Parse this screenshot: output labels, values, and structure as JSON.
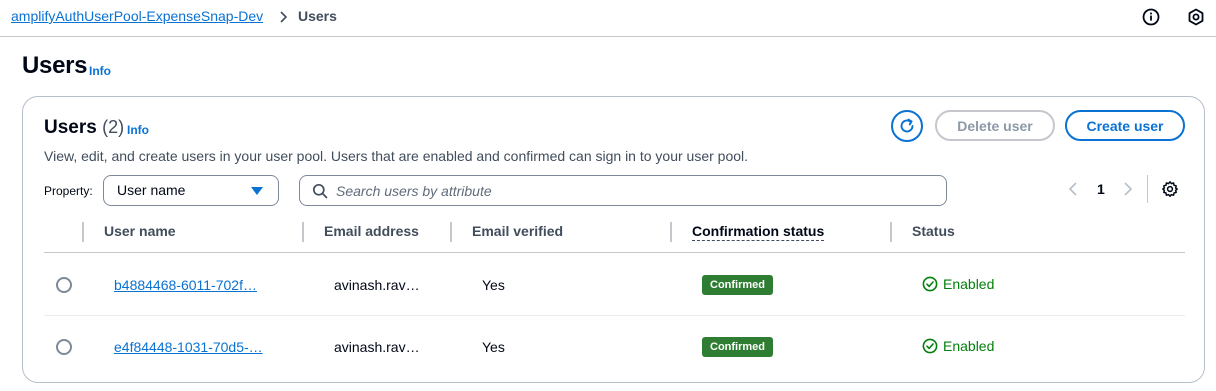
{
  "breadcrumb": {
    "parent": "amplifyAuthUserPool-ExpenseSnap-Dev",
    "current": "Users"
  },
  "top_icons": [
    "info-icon",
    "settings-icon"
  ],
  "page": {
    "title": "Users",
    "info": "Info"
  },
  "container": {
    "title": "Users",
    "count": "(2)",
    "info": "Info",
    "description": "View, edit, and create users in your user pool. Users that are enabled and confirmed can sign in to your user pool.",
    "refresh_icon": "refresh-icon",
    "delete_label": "Delete user",
    "create_label": "Create user"
  },
  "filter": {
    "property_label": "Property:",
    "property_value": "User name",
    "search_placeholder": "Search users by attribute"
  },
  "pagination": {
    "current_page": "1"
  },
  "table": {
    "columns": [
      "User name",
      "Email address",
      "Email verified",
      "Confirmation status",
      "Status"
    ],
    "rows": [
      {
        "username": "b4884468-6011-702f…",
        "email": "avinash.rav…",
        "email_verified": "Yes",
        "confirmation_status": "Confirmed",
        "status": "Enabled"
      },
      {
        "username": "e4f84448-1031-70d5-…",
        "email": "avinash.rav…",
        "email_verified": "Yes",
        "confirmation_status": "Confirmed",
        "status": "Enabled"
      }
    ]
  },
  "colors": {
    "link": "#0972d3",
    "badge_confirmed": "#2e7d32",
    "status_enabled": "#037f0c"
  }
}
